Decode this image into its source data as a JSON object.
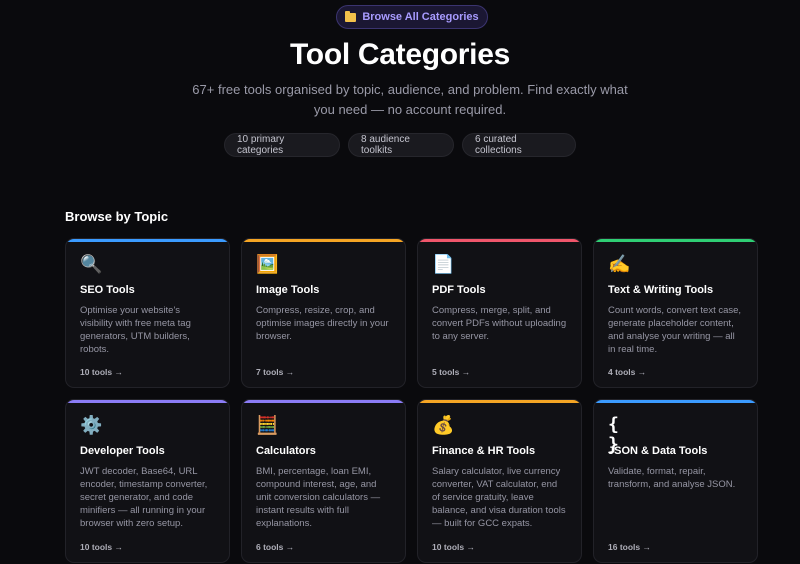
{
  "header": {
    "pill_label": "Browse All Categories",
    "title": "Tool Categories",
    "subtitle": "67+ free tools organised by topic, audience, and problem. Find exactly what you need — no account required."
  },
  "stats": [
    {
      "label": "10 primary categories"
    },
    {
      "label": "8 audience toolkits"
    },
    {
      "label": "6 curated collections"
    }
  ],
  "section": {
    "title": "Browse by Topic"
  },
  "categories": [
    {
      "name": "SEO Tools",
      "icon": "magnifier-icon",
      "glyph": "🔍",
      "accent": "#3b9bff",
      "desc": "Optimise your website's visibility with free meta tag generators, UTM builders, robots.",
      "count": "10 tools →"
    },
    {
      "name": "Image Tools",
      "icon": "picture-icon",
      "glyph": "🖼️",
      "accent": "#f5a524",
      "desc": "Compress, resize, crop, and optimise images directly in your browser.",
      "count": "7 tools →"
    },
    {
      "name": "PDF Tools",
      "icon": "document-icon",
      "glyph": "📄",
      "accent": "#f0566b",
      "desc": "Compress, merge, split, and convert PDFs without uploading to any server.",
      "count": "5 tools →"
    },
    {
      "name": "Text & Writing Tools",
      "icon": "writing-hand-icon",
      "glyph": "✍️",
      "accent": "#2fcf74",
      "desc": "Count words, convert text case, generate placeholder content, and analyse your writing — all in real time.",
      "count": "4 tools →"
    },
    {
      "name": "Developer Tools",
      "icon": "gear-icon",
      "glyph": "⚙️",
      "accent": "#8b7cf6",
      "desc": "JWT decoder, Base64, URL encoder, timestamp converter, secret generator, and code minifiers — all running in your browser with zero setup.",
      "count": "10 tools →"
    },
    {
      "name": "Calculators",
      "icon": "abacus-icon",
      "glyph": "🧮",
      "accent": "#8b7cf6",
      "desc": "BMI, percentage, loan EMI, compound interest, age, and unit conversion calculators — instant results with full explanations.",
      "count": "6 tools →"
    },
    {
      "name": "Finance & HR Tools",
      "icon": "money-bag-icon",
      "glyph": "💰",
      "accent": "#f5a524",
      "desc": "Salary calculator, live currency converter, VAT calculator, end of service gratuity, leave balance, and visa duration tools — built for GCC expats.",
      "count": "10 tools →"
    },
    {
      "name": "JSON & Data Tools",
      "icon": "braces-icon",
      "glyph": "{ }",
      "accent": "#3b9bff",
      "desc": "Validate, format, repair, transform, and analyse JSON.",
      "count": "16 tools →"
    }
  ]
}
